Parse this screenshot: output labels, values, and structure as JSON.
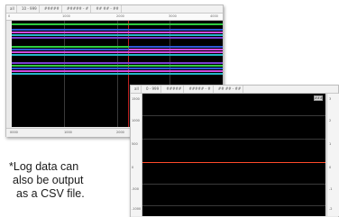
{
  "window_bars": {
    "toolbar_items": [
      "all",
      "10 - 999",
      "#####",
      "##### - #",
      "## ## - ##"
    ],
    "ruler_ticks": [
      "0",
      "1000",
      "2000",
      "3000",
      "4000"
    ],
    "footer_ticks": [
      "0000",
      "1000",
      "2000",
      "3000"
    ],
    "bars": [
      {
        "color": "#2ecc40"
      },
      {
        "color": "#2e5bd6"
      },
      {
        "color": "#d04be0"
      },
      {
        "color": "#24b8c8"
      },
      {
        "color": "#7a3fd0"
      },
      {
        "color": "#2ecc40"
      },
      {
        "color": "#2e5bd6"
      },
      {
        "color": "#d04be0"
      },
      {
        "color": "#24b8c8"
      },
      {
        "color": "#7a3fd0"
      },
      {
        "color": "#2ecc40"
      },
      {
        "color": "#2e5bd6"
      },
      {
        "color": "#d04be0"
      },
      {
        "color": "#24b8c8"
      }
    ]
  },
  "window_graph": {
    "toolbar_items": [
      "all",
      "0 - 999",
      "#####",
      "##### - #",
      "## ## - ##"
    ],
    "y_ticks": [
      "1500",
      "1000",
      "500",
      "0",
      "-500",
      "-1000"
    ],
    "right_ticks": [
      "3",
      "2",
      "1",
      "0",
      "-1",
      "-2"
    ],
    "button_label": "###",
    "trace_color": "#ff4a2a"
  },
  "caption": {
    "line1": "*Log data can",
    "line2": "also be output",
    "line3": "as a CSV file."
  }
}
